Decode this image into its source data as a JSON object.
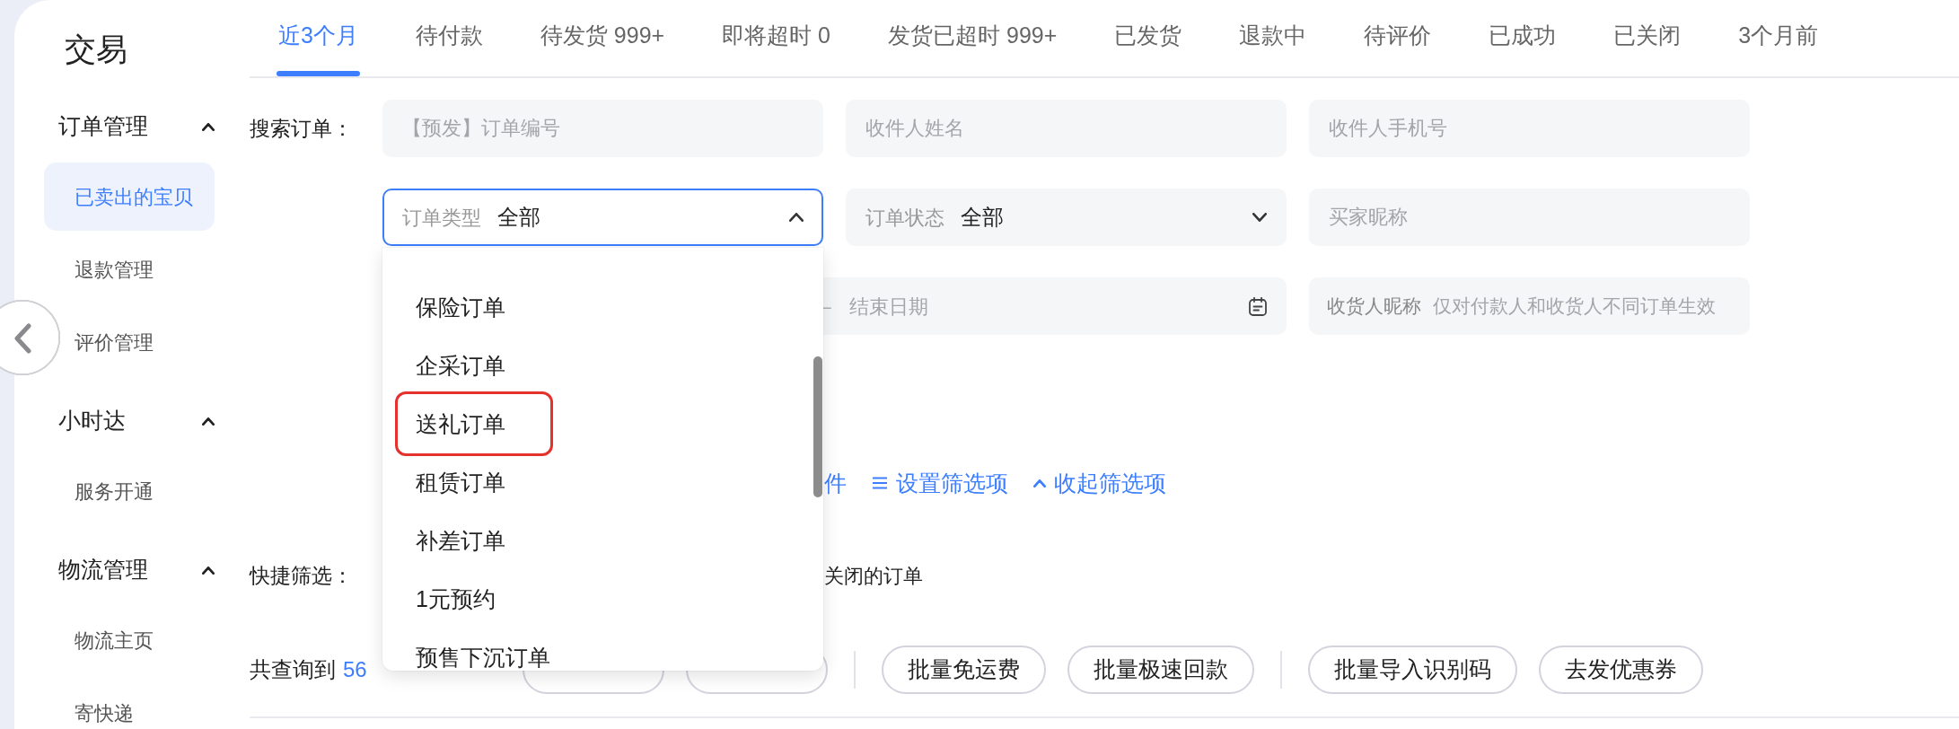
{
  "sidebar": {
    "title": "交易",
    "groups": [
      {
        "title": "订单管理",
        "expanded": true,
        "items": [
          {
            "label": "已卖出的宝贝",
            "selected": true
          },
          {
            "label": "退款管理",
            "selected": false
          },
          {
            "label": "评价管理",
            "selected": false
          }
        ]
      },
      {
        "title": "小时达",
        "expanded": true,
        "items": [
          {
            "label": "服务开通",
            "selected": false
          }
        ]
      },
      {
        "title": "物流管理",
        "expanded": true,
        "items": [
          {
            "label": "物流主页",
            "selected": false
          },
          {
            "label": "寄快递",
            "selected": false
          }
        ]
      }
    ]
  },
  "tabs": [
    {
      "label": "近3个月",
      "selected": true
    },
    {
      "label": "待付款",
      "selected": false
    },
    {
      "label": "待发货 999+",
      "selected": false
    },
    {
      "label": "即将超时 0",
      "selected": false
    },
    {
      "label": "发货已超时 999+",
      "selected": false
    },
    {
      "label": "已发货",
      "selected": false
    },
    {
      "label": "退款中",
      "selected": false
    },
    {
      "label": "待评价",
      "selected": false
    },
    {
      "label": "已成功",
      "selected": false
    },
    {
      "label": "已关闭",
      "selected": false
    },
    {
      "label": "3个月前",
      "selected": false
    }
  ],
  "search": {
    "label": "搜索订单：",
    "fields": [
      {
        "kind": "input",
        "placeholder": "【预发】订单编号"
      },
      {
        "kind": "input",
        "placeholder": "收件人姓名"
      },
      {
        "kind": "input",
        "placeholder": "收件人手机号"
      },
      {
        "kind": "select",
        "label": "订单类型",
        "value": "全部",
        "expanded": true,
        "options": [
          {
            "label": "保险订单",
            "highlighted": false
          },
          {
            "label": "企采订单",
            "highlighted": false
          },
          {
            "label": "送礼订单",
            "highlighted": true
          },
          {
            "label": "租赁订单",
            "highlighted": false
          },
          {
            "label": "补差订单",
            "highlighted": false
          },
          {
            "label": "1元预约",
            "highlighted": false
          },
          {
            "label": "预售下沉订单",
            "highlighted": false
          }
        ]
      },
      {
        "kind": "select",
        "label": "订单状态",
        "value": "全部",
        "expanded": false
      },
      {
        "kind": "input",
        "placeholder": "买家昵称"
      },
      {
        "kind": "date-range",
        "separator": "–",
        "end_placeholder": "结束日期"
      },
      {
        "kind": "input",
        "label": "收货人昵称",
        "placeholder": "仅对付款人和收货人不同订单生效"
      }
    ]
  },
  "filter_links": [
    {
      "kind": "plain",
      "label": "件"
    },
    {
      "kind": "settings",
      "label": "设置筛选项"
    },
    {
      "kind": "collapse",
      "label": "收起筛选项"
    }
  ],
  "quick_filter": {
    "label": "快捷筛选：",
    "items": [
      "关闭的订单"
    ]
  },
  "results": {
    "label": "共查询到",
    "count": "56"
  },
  "button_groups": [
    [
      {
        "kind": "covered"
      },
      {
        "kind": "covered"
      }
    ],
    [
      {
        "kind": "button",
        "label": "批量免运费"
      },
      {
        "kind": "button",
        "label": "批量极速回款"
      }
    ],
    [
      {
        "kind": "button",
        "label": "批量导入识别码"
      },
      {
        "kind": "button",
        "label": "去发优惠券"
      }
    ]
  ]
}
